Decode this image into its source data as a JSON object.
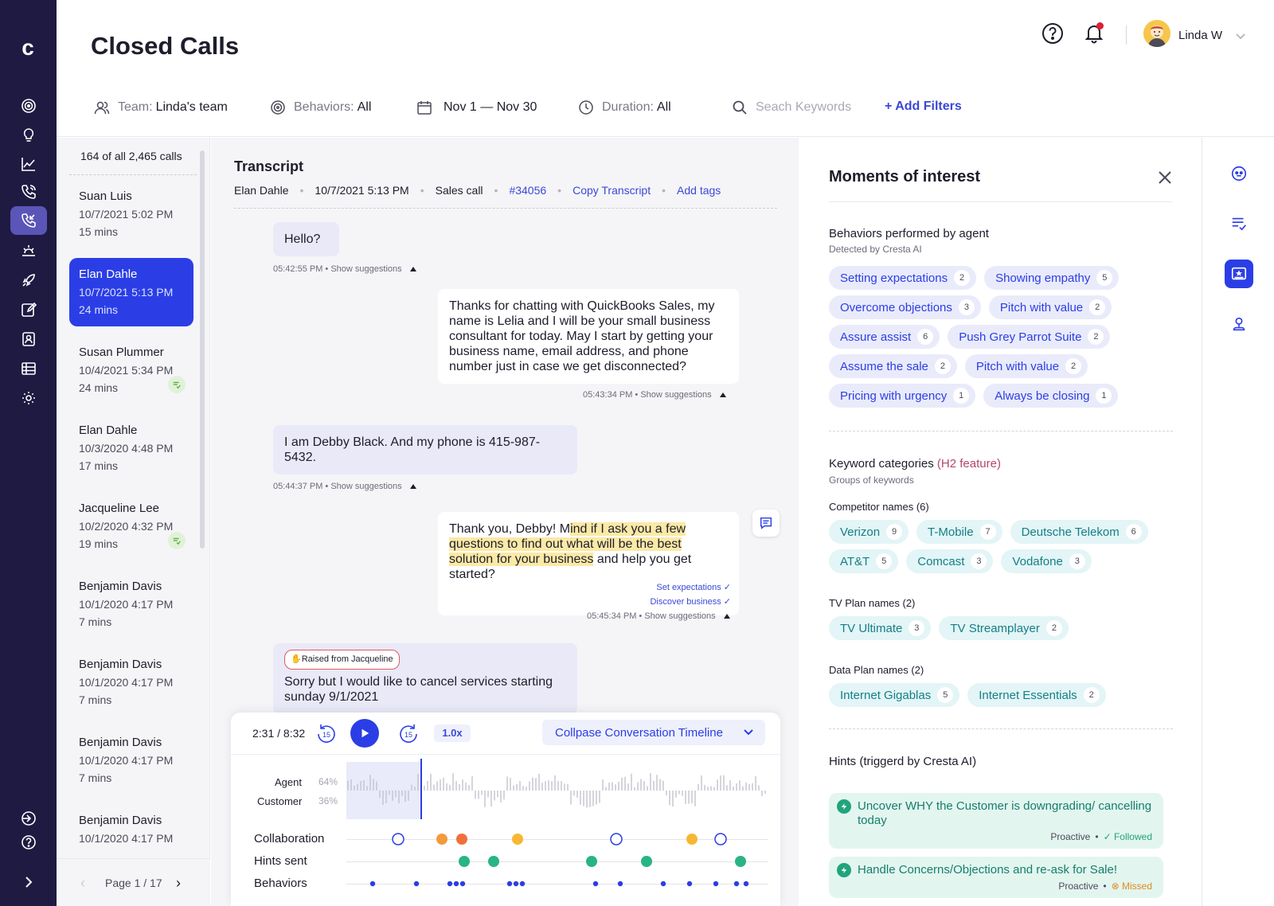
{
  "app": {
    "logo": "c",
    "title": "Closed Calls"
  },
  "nav": {
    "items": [
      {
        "icon": "target-icon"
      },
      {
        "icon": "lightbulb-icon"
      },
      {
        "icon": "chart-icon"
      },
      {
        "icon": "phone-icon"
      },
      {
        "icon": "phone-incoming-icon",
        "active": true
      },
      {
        "icon": "sunrise-icon"
      },
      {
        "icon": "rocket-icon"
      },
      {
        "icon": "edit-icon"
      },
      {
        "icon": "contact-icon"
      },
      {
        "icon": "table-icon"
      },
      {
        "icon": "settings-icon"
      }
    ],
    "bottom": [
      {
        "icon": "login-icon"
      },
      {
        "icon": "help-icon"
      }
    ],
    "expand_icon": "chevron-right-icon"
  },
  "header": {
    "user_name": "Linda W",
    "notification_dot": "#e01e37"
  },
  "filters": {
    "team_label": "Team:",
    "team_value": "Linda's team",
    "behaviors_label": "Behaviors:",
    "behaviors_value": "All",
    "date_value": "Nov 1 — Nov 30",
    "duration_label": "Duration:",
    "duration_value": "All",
    "search_placeholder": "Seach Keywords",
    "add_filters": "+ Add Filters"
  },
  "calls": {
    "count_label": "164 of all 2,465 calls",
    "items": [
      {
        "name": "Suan Luis",
        "date": "10/7/2021 5:02 PM",
        "duration": "15 mins"
      },
      {
        "name": "Elan Dahle",
        "date": "10/7/2021 5:13 PM",
        "duration": "24 mins",
        "active": true
      },
      {
        "name": "Susan Plummer",
        "date": "10/4/2021 5:34 PM",
        "duration": "24 mins",
        "badge": true
      },
      {
        "name": "Elan Dahle",
        "date": "10/3/2020 4:48 PM",
        "duration": "17 mins"
      },
      {
        "name": "Jacqueline Lee",
        "date": "10/2/2020 4:32 PM",
        "duration": "19 mins",
        "badge": true
      },
      {
        "name": "Benjamin Davis",
        "date": "10/1/2020 4:17 PM",
        "duration": "7 mins"
      },
      {
        "name": "Benjamin Davis",
        "date": "10/1/2020 4:17 PM",
        "duration": "7 mins"
      },
      {
        "name": "Benjamin Davis",
        "date": "10/1/2020 4:17 PM",
        "duration": "7 mins"
      },
      {
        "name": "Benjamin Davis",
        "date": "10/1/2020 4:17 PM",
        "duration": ""
      }
    ],
    "pager": "Page 1 / 17"
  },
  "transcript": {
    "title": "Transcript",
    "agent": "Elan Dahle",
    "datetime": "10/7/2021 5:13 PM",
    "call_type": "Sales call",
    "call_id": "#34056",
    "copy_label": "Copy Transcript",
    "tags_label": "Add tags",
    "show_suggestions": "Show suggestions",
    "messages": [
      {
        "text": "Hello?",
        "time": "05:42:55 PM"
      },
      {
        "text": "Thanks for chatting with QuickBooks Sales, my name is Lelia and I will be your small business consultant for today. May I start by getting your business name, email address, and phone number just in case we get disconnected?",
        "time": "05:43:34 PM"
      },
      {
        "text": "I am Debby Black. And my phone is 415-987-5432.",
        "time": "05:44:37 PM"
      },
      {
        "text_pre": "Thank you, Debby! M",
        "text_hl": "ind if I ask you a few questions to find out what will be the best solution for your business",
        "text_post": " and help you get started?",
        "time": "05:45:34 PM",
        "behaviors": [
          "Set expectations",
          "Discover business"
        ]
      },
      {
        "raised": "Raised from Jacqueline",
        "text": "Sorry but I would like to cancel services starting sunday 9/1/2021"
      }
    ]
  },
  "player": {
    "time": "2:31 / 8:32",
    "skip": "15",
    "speed": "1.0x",
    "collapse_label": "Collpase Conversation Timeline",
    "agent_label": "Agent",
    "agent_pct": "64%",
    "customer_label": "Customer",
    "customer_pct": "36%",
    "rows": [
      "Collaboration",
      "Hints sent",
      "Behaviors"
    ]
  },
  "moments": {
    "title": "Moments of interest",
    "behaviors_title": "Behaviors performed by agent",
    "behaviors_sub": "Detected by Cresta AI",
    "behaviors": [
      [
        {
          "label": "Setting expectations",
          "count": "2"
        },
        {
          "label": "Showing empathy",
          "count": "5"
        }
      ],
      [
        {
          "label": "Overcome objections",
          "count": "3"
        },
        {
          "label": "Pitch with value",
          "count": "2"
        }
      ],
      [
        {
          "label": "Assure assist",
          "count": "6"
        },
        {
          "label": "Push Grey Parrot Suite",
          "count": "2"
        }
      ],
      [
        {
          "label": "Assume the sale",
          "count": "2"
        },
        {
          "label": "Pitch with value",
          "count": "2"
        }
      ],
      [
        {
          "label": "Pricing with urgency",
          "count": "1"
        },
        {
          "label": "Always be closing",
          "count": "1"
        }
      ]
    ],
    "keywords_title": "Keyword categories",
    "keywords_tag": "(H2 feature)",
    "keywords_sub": "Groups of keywords",
    "competitor_title": "Competitor names (6)",
    "competitors": [
      [
        {
          "label": "Verizon",
          "count": "9"
        },
        {
          "label": "T-Mobile",
          "count": "7"
        },
        {
          "label": "Deutsche Telekom",
          "count": "6"
        }
      ],
      [
        {
          "label": "AT&T",
          "count": "5"
        },
        {
          "label": "Comcast",
          "count": "3"
        },
        {
          "label": "Vodafone",
          "count": "3"
        }
      ]
    ],
    "tv_title": "TV Plan names (2)",
    "tv": [
      {
        "label": "TV Ultimate",
        "count": "3"
      },
      {
        "label": "TV Streamplayer",
        "count": "2"
      }
    ],
    "data_title": "Data Plan names (2)",
    "data": [
      {
        "label": "Internet Gigablas",
        "count": "5"
      },
      {
        "label": "Internet Essentials",
        "count": "2"
      }
    ],
    "hints_title": "Hints (triggerd by Cresta AI)",
    "hints": [
      {
        "text": "Uncover WHY the Customer is downgrading/ cancelling today",
        "type": "Proactive",
        "status": "Followed"
      },
      {
        "text": "Handle Concerns/Objections and re-ask for Sale!",
        "type": "Proactive",
        "status": "Missed"
      }
    ]
  },
  "colors": {
    "nav_bg": "#1e1a42",
    "accent": "#2b3ee6",
    "behavior_chip": "#e9ebfb",
    "keyword_chip": "#e3f5f6",
    "hint_bg": "#e3f5ef",
    "highlight": "#fbe9a6"
  }
}
